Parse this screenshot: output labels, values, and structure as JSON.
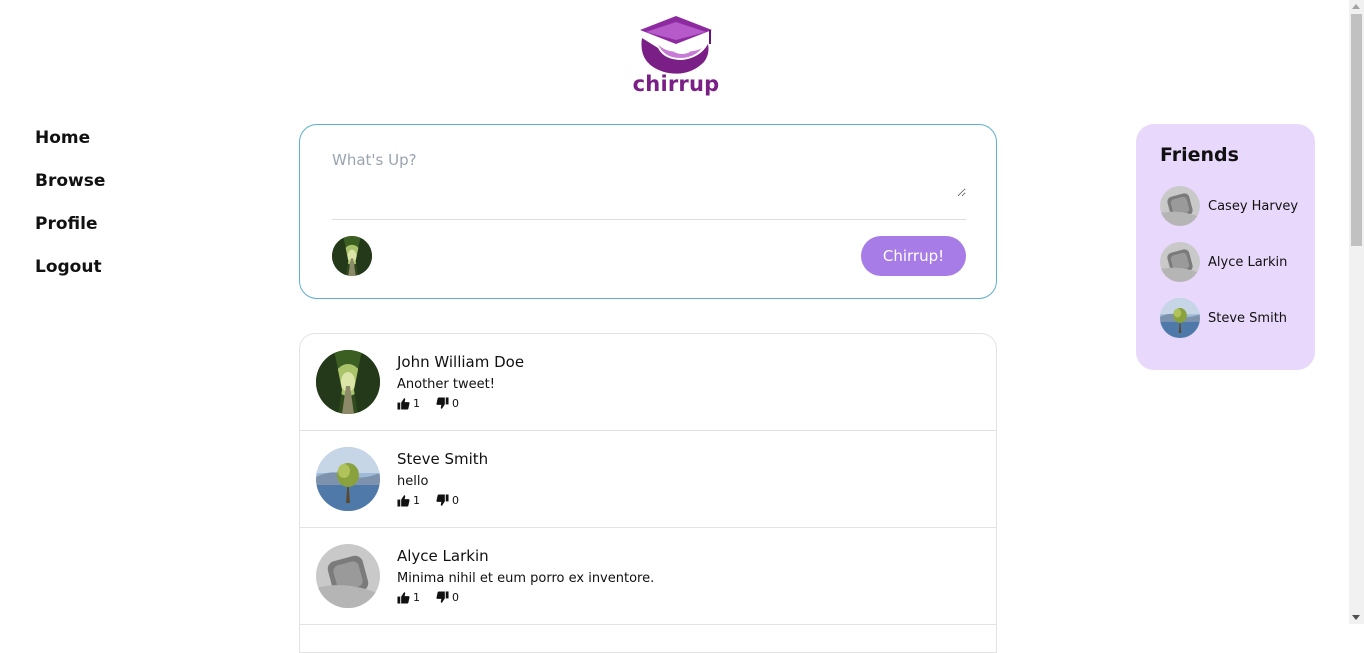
{
  "brand": {
    "name": "chirrup"
  },
  "nav": [
    {
      "label": "Home"
    },
    {
      "label": "Browse"
    },
    {
      "label": "Profile"
    },
    {
      "label": "Logout"
    }
  ],
  "composer": {
    "placeholder": "What's Up?",
    "submit_label": "Chirrup!"
  },
  "feed": [
    {
      "author": "John William Doe",
      "text": "Another tweet!",
      "likes": "1",
      "dislikes": "0",
      "avatar": "forest-avatar"
    },
    {
      "author": "Steve Smith",
      "text": "hello",
      "likes": "1",
      "dislikes": "0",
      "avatar": "lake-tree-avatar"
    },
    {
      "author": "Alyce Larkin",
      "text": "Minima nihil et eum porro ex inventore.",
      "likes": "1",
      "dislikes": "0",
      "avatar": "default-avatar"
    }
  ],
  "friends": {
    "title": "Friends",
    "items": [
      {
        "name": "Casey Harvey",
        "avatar": "default-avatar"
      },
      {
        "name": "Alyce Larkin",
        "avatar": "default-avatar"
      },
      {
        "name": "Steve Smith",
        "avatar": "lake-tree-avatar"
      }
    ]
  },
  "colors": {
    "accent": "#a77ce6",
    "friends_bg": "#e8d8fb",
    "composer_border": "#5fb0cf",
    "brand": "#7a1f86"
  }
}
